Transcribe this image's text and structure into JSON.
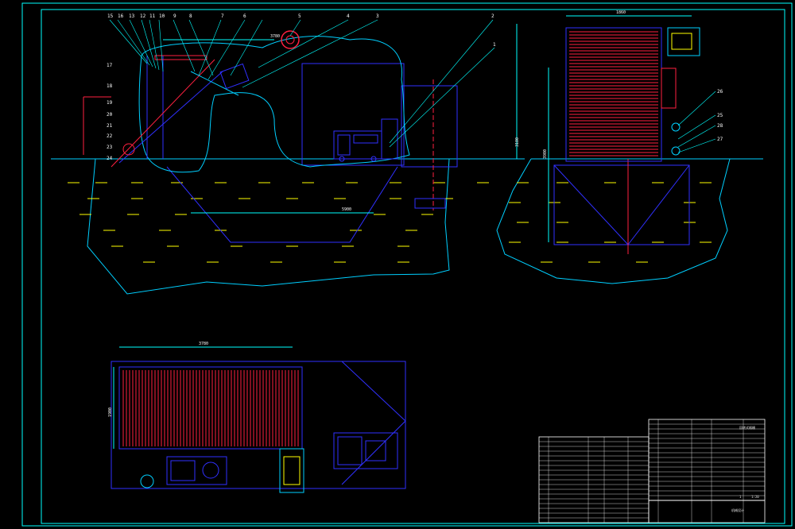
{
  "colors": {
    "background": "#000000",
    "frame": "#00ffff",
    "wall": "#00cfff",
    "water": "#ffff00",
    "machine": "#ff2040",
    "blue": "#3030ff",
    "green": "#00ff00",
    "white": "#ffffff"
  },
  "drawing": {
    "part_numbers_top": [
      "15",
      "16",
      "13",
      "12",
      "11",
      "10",
      "9",
      "8",
      "7",
      "6",
      "5",
      "4",
      "3",
      "2",
      "1"
    ],
    "part_numbers_left": [
      "17",
      "18",
      "19",
      "20",
      "21",
      "22",
      "23",
      "24"
    ],
    "part_numbers_right": [
      "26",
      "25",
      "28",
      "27"
    ],
    "dim_front_width": "5900",
    "dim_front_span": "3780",
    "dim_front_height": "3180",
    "dim_side_width": "1860",
    "dim_side_height": "3900",
    "dim_plan_width": "3780",
    "dim_plan_depth": "1900"
  },
  "title_block": {
    "drawing_name": "回转式格栅",
    "stamp_text": "机械设计",
    "scale": "1:20",
    "sheet": "1"
  }
}
